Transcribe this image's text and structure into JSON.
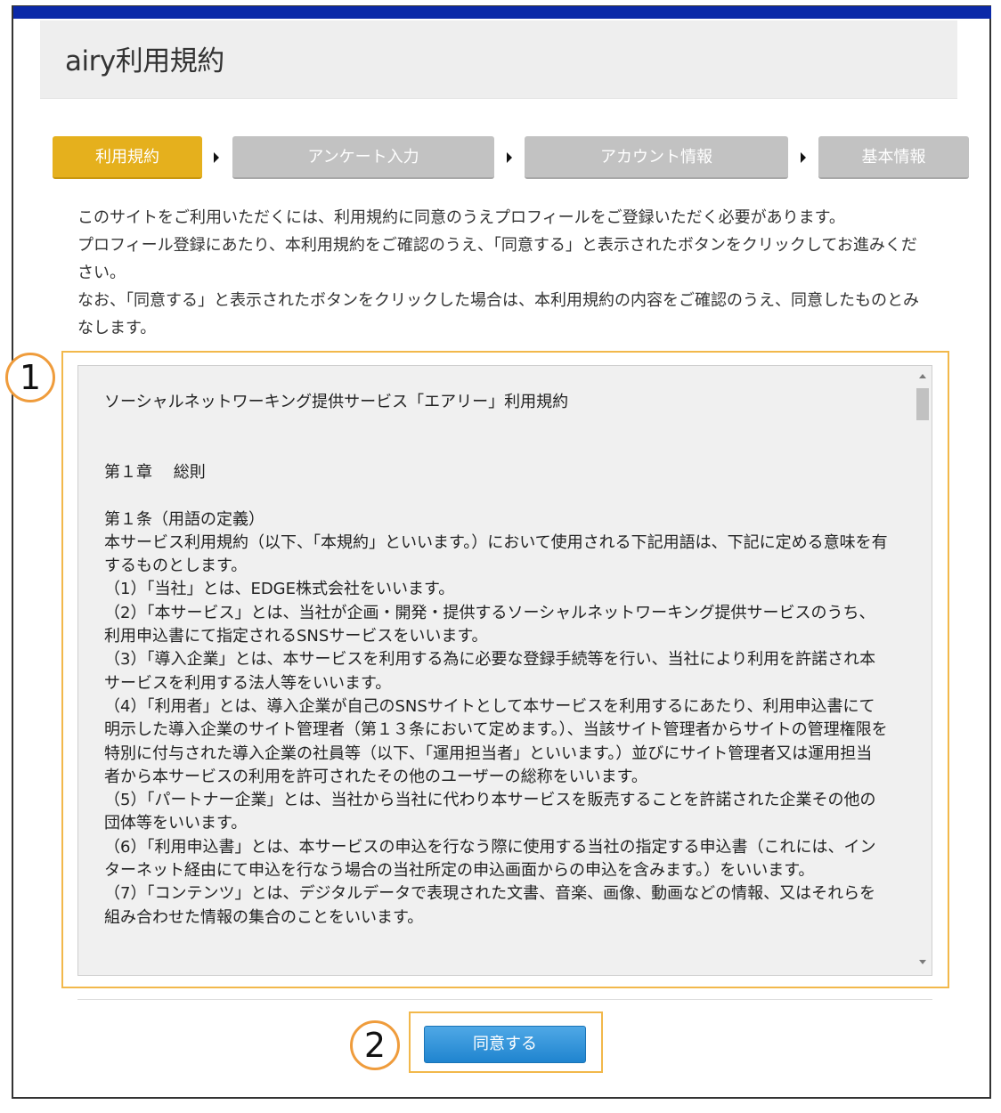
{
  "page": {
    "title": "airy利用規約"
  },
  "steps": [
    {
      "label": "利用規約",
      "state": "active"
    },
    {
      "label": "アンケート入力",
      "state": "inactive"
    },
    {
      "label": "アカウント情報",
      "state": "inactive"
    },
    {
      "label": "基本情報",
      "state": "inactive"
    }
  ],
  "intro": {
    "line1": "このサイトをご利用いただくには、利用規約に同意のうえプロフィールをご登録いただく必要があります。",
    "line2": "プロフィール登録にあたり、本利用規約をご確認のうえ、「同意する」と表示されたボタンをクリックしてお進みください。",
    "line3": "なお、「同意する」と表示されたボタンをクリックした場合は、本利用規約の内容をご確認のうえ、同意したものとみなします。"
  },
  "terms": {
    "heading": "ソーシャルネットワーキング提供サービス「エアリー」利用規約",
    "chapter": "第１章　 総則",
    "article_title": "第１条（用語の定義）",
    "article_body": "本サービス利用規約（以下、「本規約」といいます。）において使用される下記用語は、下記に定める意味を有するものとします。",
    "items": [
      "（1）「当社」とは、EDGE株式会社をいいます。",
      "（2）「本サービス」とは、当社が企画・開発・提供するソーシャルネットワーキング提供サービスのうち、利用申込書にて指定されるSNSサービスをいいます。",
      "（3）「導入企業」とは、本サービスを利用する為に必要な登録手続等を行い、当社により利用を許諾され本サービスを利用する法人等をいいます。",
      "（4）「利用者」とは、導入企業が自己のSNSサイトとして本サービスを利用するにあたり、利用申込書にて明示した導入企業のサイト管理者（第１３条において定めます。）、当該サイト管理者からサイトの管理権限を特別に付与された導入企業の社員等（以下、「運用担当者」といいます。）並びにサイト管理者又は運用担当者から本サービスの利用を許可されたその他のユーザーの総称をいいます。",
      "（5）「パートナー企業」とは、当社から当社に代わり本サービスを販売することを許諾された企業その他の団体等をいいます。",
      "（6）「利用申込書」とは、本サービスの申込を行なう際に使用する当社の指定する申込書（これには、インターネット経由にて申込を行なう場合の当社所定の申込画面からの申込を含みます。）をいいます。",
      "（7）「コンテンツ」とは、デジタルデータで表現された文書、音楽、画像、動画などの情報、又はそれらを組み合わせた情報の集合のことをいいます。"
    ]
  },
  "annotations": {
    "marker1": "1",
    "marker2": "2",
    "color": "#ef9c3c"
  },
  "agree_button": {
    "label": "同意する",
    "color": "#1f84cf"
  },
  "colors": {
    "topbar": "#0b29a8",
    "step_active": "#e5b01d",
    "step_inactive": "#c2c2c2"
  }
}
